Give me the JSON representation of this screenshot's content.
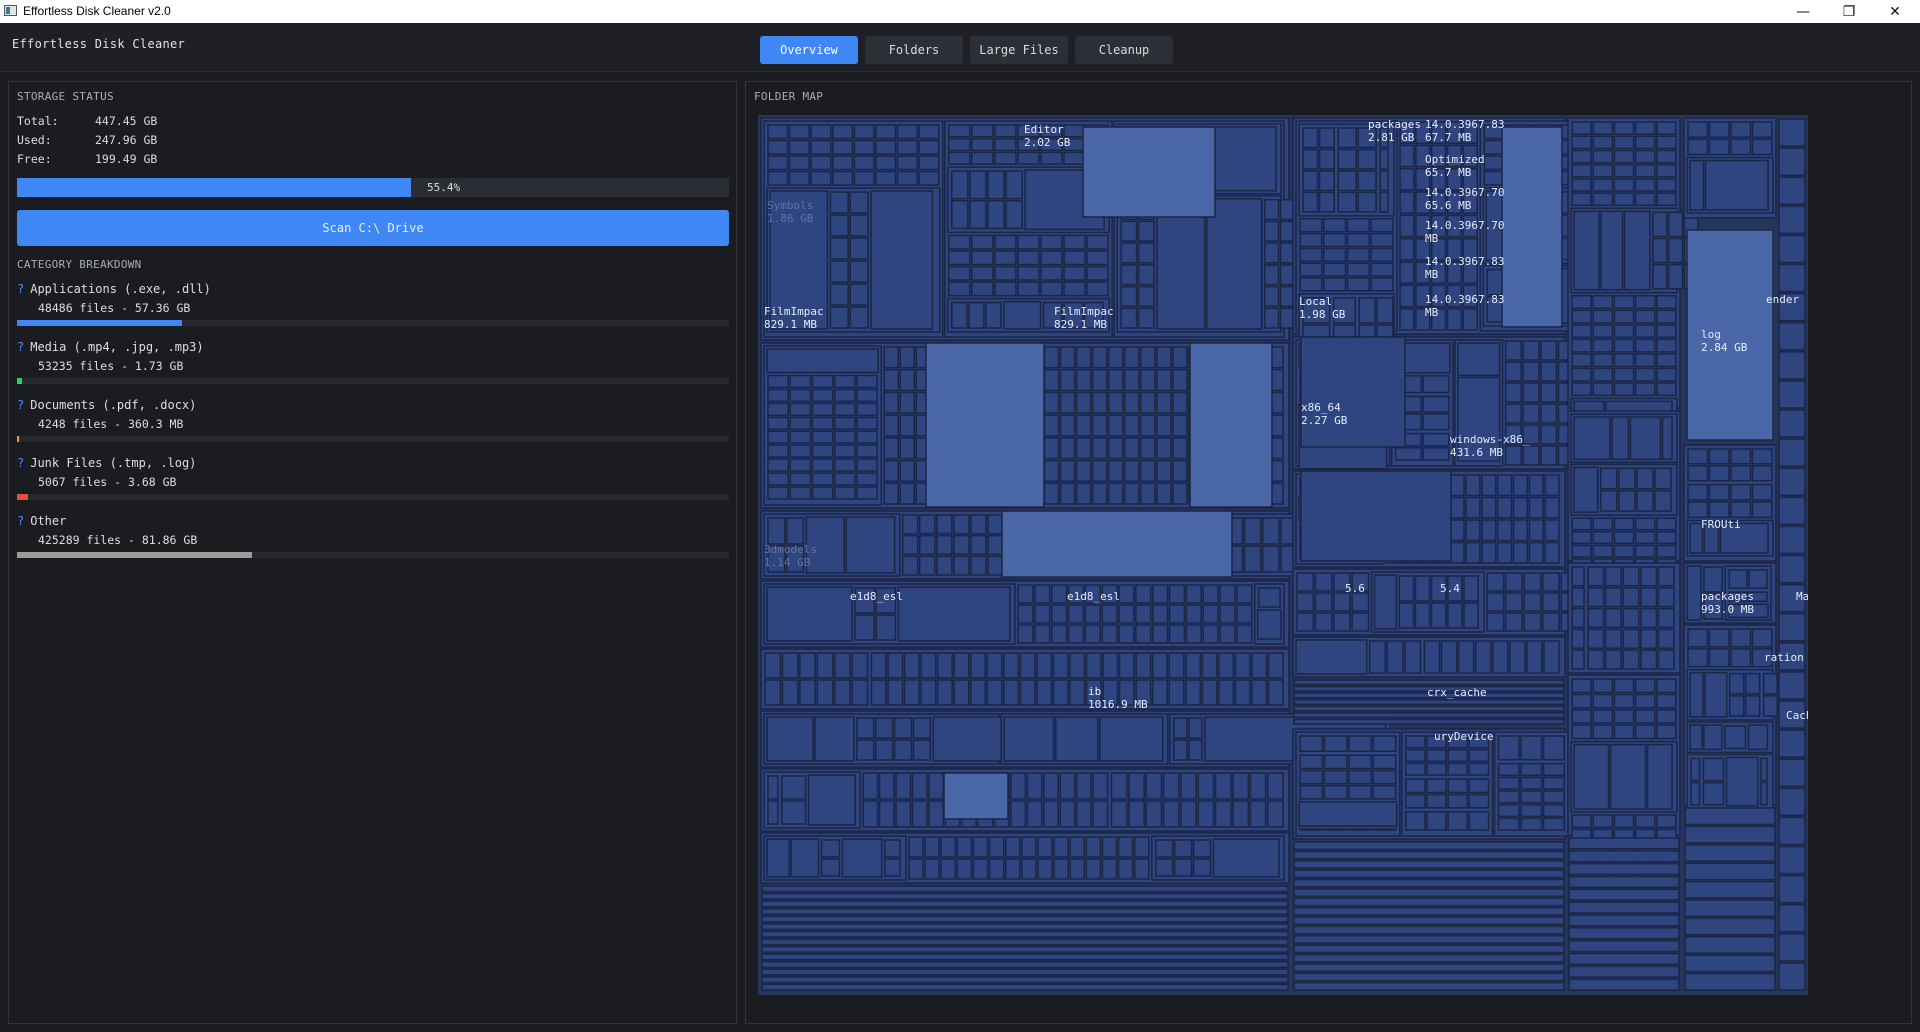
{
  "window": {
    "title": "Effortless Disk Cleaner v2.0",
    "minimize_glyph": "—",
    "maximize_glyph": "❐",
    "close_glyph": "✕"
  },
  "header": {
    "app_title": "Effortless Disk Cleaner",
    "tabs": [
      {
        "label": "Overview",
        "active": true
      },
      {
        "label": "Folders",
        "active": false
      },
      {
        "label": "Large Files",
        "active": false
      },
      {
        "label": "Cleanup",
        "active": false
      }
    ]
  },
  "storage": {
    "section_title": "STORAGE STATUS",
    "total_label": "Total:",
    "total_value": "447.45 GB",
    "used_label": "Used:",
    "used_value": "247.96 GB",
    "free_label": "Free:",
    "free_value": "199.49 GB",
    "used_percent": 55.4,
    "used_percent_text": "55.4%",
    "scan_button": "Scan C:\\ Drive"
  },
  "categories": {
    "section_title": "CATEGORY BREAKDOWN",
    "marker": "?",
    "items": [
      {
        "name": "Applications (.exe, .dll)",
        "summary": "48486 files - 57.36 GB",
        "fraction": 0.232,
        "color": "#3f87f5"
      },
      {
        "name": "Media (.mp4, .jpg, .mp3)",
        "summary": "53235 files - 1.73 GB",
        "fraction": 0.007,
        "color": "#2ecc71"
      },
      {
        "name": "Documents (.pdf, .docx)",
        "summary": "4248 files - 360.3 MB",
        "fraction": 0.0015,
        "color": "#f0a020"
      },
      {
        "name": "Junk Files (.tmp, .log)",
        "summary": "5067 files - 3.68 GB",
        "fraction": 0.015,
        "color": "#e74c3c"
      },
      {
        "name": "Other",
        "summary": "425289 files - 81.86 GB",
        "fraction": 0.33,
        "color": "#9a9a9a"
      }
    ]
  },
  "folder_map": {
    "section_title": "FOLDER MAP",
    "colors": {
      "background": "#26355a",
      "tile": "#2f4580",
      "tile_light": "#4a68a8",
      "border": "#1b2544"
    },
    "labels": [
      {
        "text": "Editor",
        "sub": "2.02 GB"
      },
      {
        "text": "packages",
        "sub": "2.81 GB"
      },
      {
        "text": "14.0.3967.83",
        "sub": "67.7 MB"
      },
      {
        "text": "Optimized",
        "sub": "65.7 MB"
      },
      {
        "text": "14.0.3967.70",
        "sub": "65.6 MB"
      },
      {
        "text": "14.0.3967.70",
        "sub": "MB"
      },
      {
        "text": "14.0.3967.83",
        "sub": "MB"
      },
      {
        "text": "14.0.3967.83",
        "sub": "MB"
      },
      {
        "text": "FilmImpac",
        "sub": "829.1 MB"
      },
      {
        "text": "FilmImpac",
        "sub": "829.1 MB"
      },
      {
        "text": "Local",
        "sub": "1.98 GB"
      },
      {
        "text": "x86_64",
        "sub": "2.27 GB"
      },
      {
        "text": "windows-x86_",
        "sub": "431.6 MB"
      },
      {
        "text": "log",
        "sub": "2.84 GB"
      },
      {
        "text": "FROUti",
        "sub": ""
      },
      {
        "text": "e1d8_esl",
        "sub": ""
      },
      {
        "text": "e1d8_esl",
        "sub": ""
      },
      {
        "text": "ib",
        "sub": "1016.9 MB"
      },
      {
        "text": "packages",
        "sub": "993.0 MB"
      },
      {
        "text": "crx_cache",
        "sub": ""
      },
      {
        "text": "Cache",
        "sub": ""
      },
      {
        "text": "uryDevice",
        "sub": ""
      },
      {
        "text": "5.6",
        "sub": ""
      },
      {
        "text": "5.4",
        "sub": ""
      },
      {
        "text": "3dmodels",
        "sub": "1.14 GB"
      },
      {
        "text": "Symbols",
        "sub": "1.86 GB"
      },
      {
        "text": "Manager",
        "sub": ""
      },
      {
        "text": "ender",
        "sub": ""
      },
      {
        "text": "ration",
        "sub": ""
      }
    ]
  }
}
